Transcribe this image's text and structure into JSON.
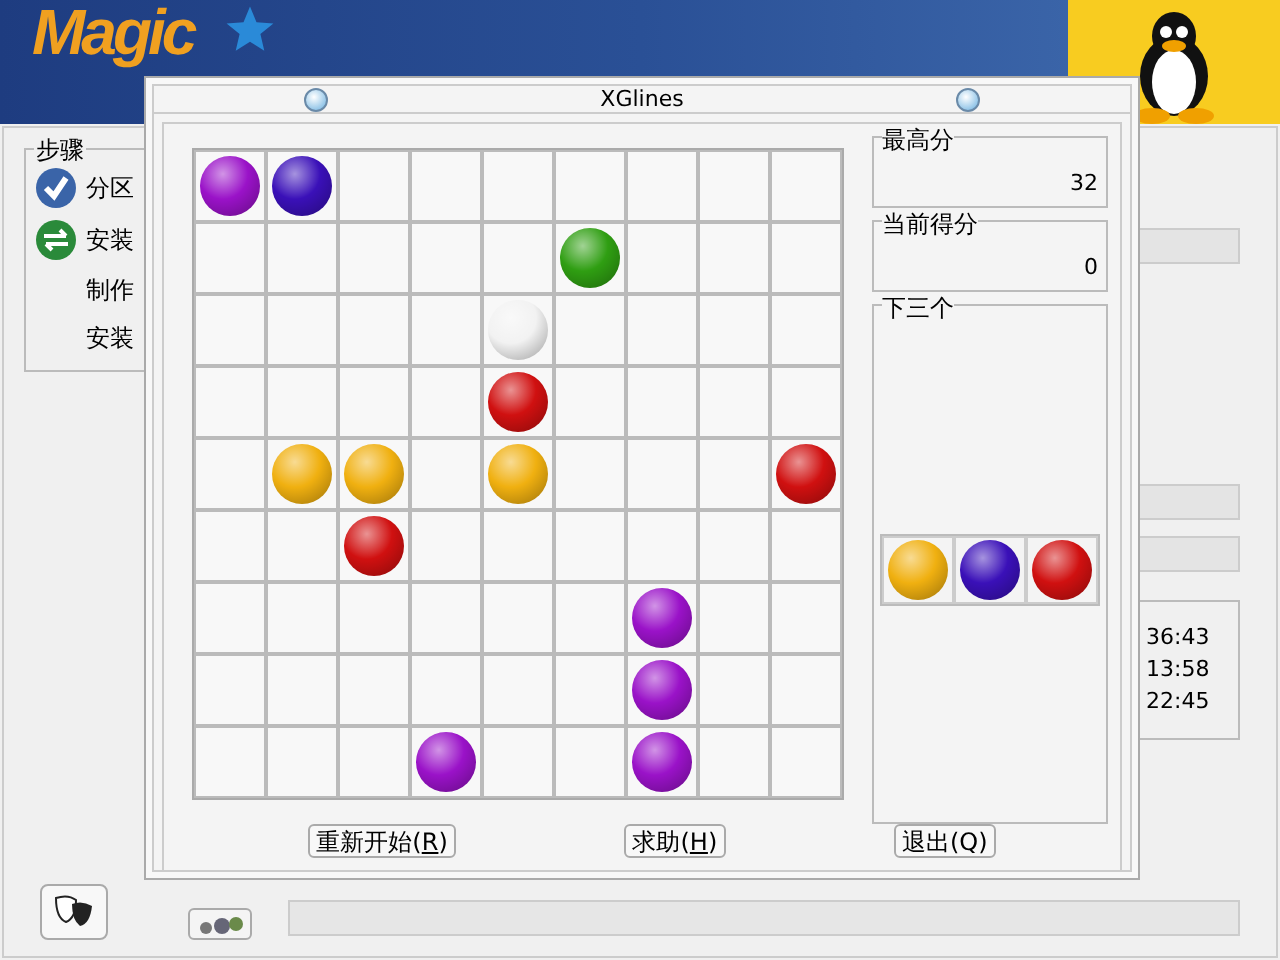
{
  "installer": {
    "logo": "Magic",
    "steps": {
      "title": "步骤",
      "items": [
        {
          "label": "分区",
          "kind": "done"
        },
        {
          "label": "安装",
          "kind": "current"
        },
        {
          "label": "制作",
          "kind": "pending"
        },
        {
          "label": "安装",
          "kind": "pending"
        }
      ]
    },
    "times": [
      "36:43",
      "13:58",
      "22:45"
    ]
  },
  "window": {
    "title": "XGlines",
    "board": [
      [
        {
          "filled": true,
          "color": "#9a12c8"
        },
        {
          "filled": true,
          "color": "#3a10b8"
        },
        {
          "filled": false
        },
        {
          "filled": false
        },
        {
          "filled": false
        },
        {
          "filled": false
        },
        {
          "filled": false
        },
        {
          "filled": false
        },
        {
          "filled": false
        }
      ],
      [
        {
          "filled": false
        },
        {
          "filled": false
        },
        {
          "filled": false
        },
        {
          "filled": false
        },
        {
          "filled": false
        },
        {
          "filled": true,
          "color": "#2f9e12"
        },
        {
          "filled": false
        },
        {
          "filled": false
        },
        {
          "filled": false
        }
      ],
      [
        {
          "filled": false
        },
        {
          "filled": false
        },
        {
          "filled": false
        },
        {
          "filled": false
        },
        {
          "filled": true,
          "color": "#f2f2f2"
        },
        {
          "filled": false
        },
        {
          "filled": false
        },
        {
          "filled": false
        },
        {
          "filled": false
        }
      ],
      [
        {
          "filled": false
        },
        {
          "filled": false
        },
        {
          "filled": false
        },
        {
          "filled": false
        },
        {
          "filled": true,
          "color": "#d01010"
        },
        {
          "filled": false
        },
        {
          "filled": false
        },
        {
          "filled": false
        },
        {
          "filled": false
        }
      ],
      [
        {
          "filled": false
        },
        {
          "filled": true,
          "color": "#f0b010"
        },
        {
          "filled": true,
          "color": "#f0b010"
        },
        {
          "filled": false
        },
        {
          "filled": true,
          "color": "#f0b010"
        },
        {
          "filled": false
        },
        {
          "filled": false
        },
        {
          "filled": false
        },
        {
          "filled": true,
          "color": "#d01010"
        }
      ],
      [
        {
          "filled": false
        },
        {
          "filled": false
        },
        {
          "filled": true,
          "color": "#d01010"
        },
        {
          "filled": false
        },
        {
          "filled": false
        },
        {
          "filled": false
        },
        {
          "filled": false
        },
        {
          "filled": false
        },
        {
          "filled": false
        }
      ],
      [
        {
          "filled": false
        },
        {
          "filled": false
        },
        {
          "filled": false
        },
        {
          "filled": false
        },
        {
          "filled": false
        },
        {
          "filled": false
        },
        {
          "filled": true,
          "color": "#9a12c8"
        },
        {
          "filled": false
        },
        {
          "filled": false
        }
      ],
      [
        {
          "filled": false
        },
        {
          "filled": false
        },
        {
          "filled": false
        },
        {
          "filled": false
        },
        {
          "filled": false
        },
        {
          "filled": false
        },
        {
          "filled": true,
          "color": "#9a12c8"
        },
        {
          "filled": false
        },
        {
          "filled": false
        }
      ],
      [
        {
          "filled": false
        },
        {
          "filled": false
        },
        {
          "filled": false
        },
        {
          "filled": true,
          "color": "#9a12c8"
        },
        {
          "filled": false
        },
        {
          "filled": false
        },
        {
          "filled": true,
          "color": "#9a12c8"
        },
        {
          "filled": false
        },
        {
          "filled": false
        }
      ]
    ],
    "high_score": {
      "label": "最高分",
      "value": "32"
    },
    "current_score": {
      "label": "当前得分",
      "value": "0"
    },
    "next_three": {
      "label": "下三个",
      "balls": [
        {
          "color": "#f0b010"
        },
        {
          "color": "#3a10b8"
        },
        {
          "color": "#d01010"
        }
      ]
    },
    "buttons": [
      {
        "label": "重新开始(**R**)"
      },
      {
        "label": "求助(**H**)"
      },
      {
        "label": "退出(Q)"
      }
    ]
  }
}
